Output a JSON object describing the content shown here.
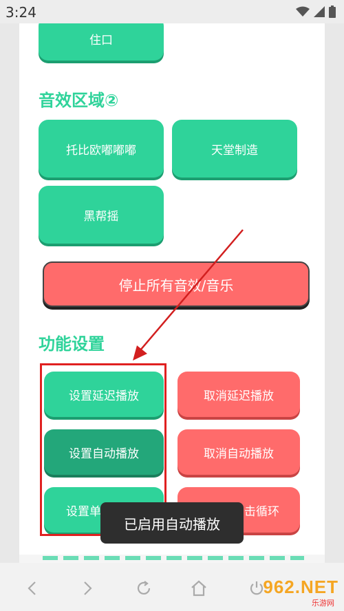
{
  "status_bar": {
    "time": "3:24"
  },
  "sections": {
    "top_partial_button": "住口",
    "sound_area_title": "音效区域②",
    "sound_buttons": [
      "托比欧嘟嘟嘟",
      "天堂制造",
      "黑帮摇"
    ],
    "stop_all_label": "停止所有音效/音乐",
    "function_title": "功能设置",
    "set_buttons": [
      "设置延迟播放",
      "设置自动播放",
      "设置单"
    ],
    "cancel_buttons": [
      "取消延迟播放",
      "取消自动播放",
      "击循环"
    ]
  },
  "toast": {
    "message": "已启用自动播放"
  },
  "watermark": {
    "brand": "962.NET",
    "sub": "乐游网"
  },
  "colors": {
    "accent_green": "#2fd39a",
    "accent_red": "#ff6b6b",
    "highlight_red": "#e02020"
  },
  "icons": {
    "status": [
      "wifi-icon",
      "signal-icon",
      "battery-icon"
    ],
    "nav": [
      "back-icon",
      "forward-icon",
      "refresh-icon",
      "home-icon",
      "power-icon"
    ]
  }
}
